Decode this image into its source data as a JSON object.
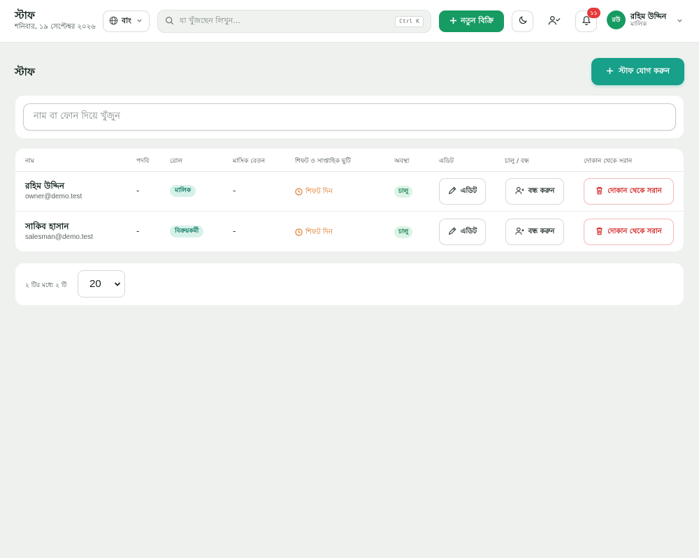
{
  "header": {
    "title": "স্টাফ",
    "date": "শনিবার, ১৯ সেপ্টেম্বর ২০২৬",
    "language_label": "বাং",
    "search_placeholder": "যা খুঁজছেন লিখুন...",
    "search_shortcut": "Ctrl K",
    "new_sale_label": "নতুন বিক্রি",
    "notification_count": "১১",
    "user": {
      "initials": "রউ",
      "name": "রহিম উদ্দিন",
      "role": "মালিক"
    }
  },
  "page": {
    "title": "স্টাফ",
    "add_staff_label": "স্টাফ যোগ করুন",
    "filter_placeholder": "নাম বা ফোন দিয়ে খুঁজুন"
  },
  "table": {
    "columns": [
      "নাম",
      "পদবি",
      "রোল",
      "মাসিক বেতন",
      "শিফট ও সাপ্তাহিক ছুটি",
      "অবস্থা",
      "এডিট",
      "চালু / বন্ধ",
      "দোকান থেকে সরান"
    ],
    "rows": [
      {
        "name": "রহিম উদ্দিন",
        "email": "owner@demo.test",
        "designation": "-",
        "role": "মালিক",
        "salary": "-",
        "shift": "শিফট দিন",
        "status": "চালু",
        "edit_label": "এডিট",
        "toggle_label": "বন্ধ করুন",
        "remove_label": "দোকান থেকে সরান"
      },
      {
        "name": "সাকিব হাসান",
        "email": "salesman@demo.test",
        "designation": "-",
        "role": "বিক্রয়কর্মী",
        "salary": "-",
        "shift": "শিফট দিন",
        "status": "চালু",
        "edit_label": "এডিট",
        "toggle_label": "বন্ধ করুন",
        "remove_label": "দোকান থেকে সরান"
      }
    ]
  },
  "pagination": {
    "summary": "২ টির মধ্যে ২ টি",
    "page_size": "20"
  },
  "colors": {
    "primary_green": "#169b62",
    "teal": "#17a08a",
    "danger": "#d32222",
    "shift_orange": "#d9731c"
  }
}
